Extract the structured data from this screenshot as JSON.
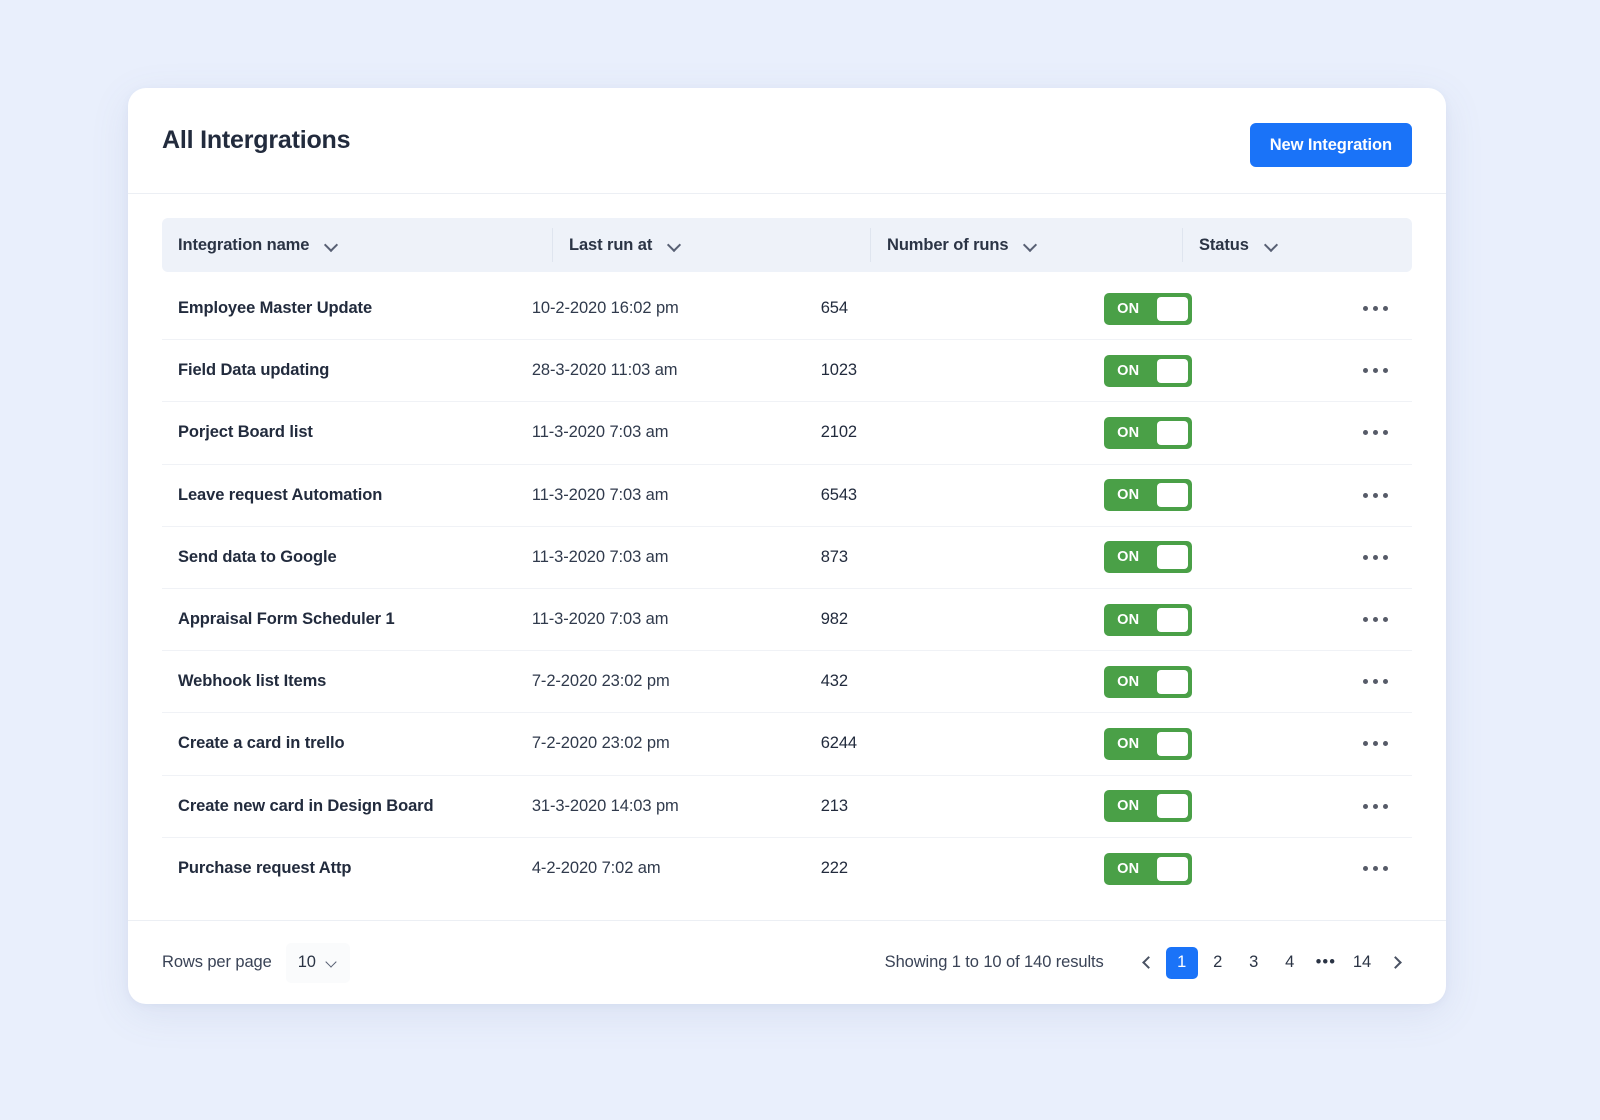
{
  "header": {
    "title": "All Intergrations",
    "new_integration_label": "New Integration"
  },
  "table": {
    "columns": [
      {
        "label": "Integration name",
        "sort_icon": "chevron-down-icon"
      },
      {
        "label": "Last run at",
        "sort_icon": "chevron-down-icon"
      },
      {
        "label": "Number of runs",
        "sort_icon": "chevron-down-icon"
      },
      {
        "label": "Status",
        "sort_icon": "chevron-down-icon"
      }
    ],
    "rows": [
      {
        "name": "Employee Master Update",
        "last_run": "10-2-2020 16:02 pm",
        "runs": "654",
        "status": "ON",
        "menu_icon": "ellipsis-horizontal-icon"
      },
      {
        "name": "Field Data updating",
        "last_run": "28-3-2020 11:03 am",
        "runs": "1023",
        "status": "ON",
        "menu_icon": "ellipsis-horizontal-icon"
      },
      {
        "name": "Porject Board list",
        "last_run": "11-3-2020 7:03 am",
        "runs": "2102",
        "status": "ON",
        "menu_icon": "ellipsis-horizontal-icon"
      },
      {
        "name": "Leave request Automation",
        "last_run": "11-3-2020 7:03 am",
        "runs": "6543",
        "status": "ON",
        "menu_icon": "ellipsis-horizontal-icon"
      },
      {
        "name": "Send data to Google",
        "last_run": "11-3-2020 7:03 am",
        "runs": "873",
        "status": "ON",
        "menu_icon": "ellipsis-horizontal-icon"
      },
      {
        "name": "Appraisal Form Scheduler 1",
        "last_run": "11-3-2020 7:03 am",
        "runs": "982",
        "status": "ON",
        "menu_icon": "ellipsis-horizontal-icon"
      },
      {
        "name": "Webhook list Items",
        "last_run": "7-2-2020 23:02 pm",
        "runs": "432",
        "status": "ON",
        "menu_icon": "ellipsis-horizontal-icon"
      },
      {
        "name": "Create a card in trello",
        "last_run": "7-2-2020 23:02 pm",
        "runs": "6244",
        "status": "ON",
        "menu_icon": "ellipsis-horizontal-icon"
      },
      {
        "name": "Create new card in Design Board",
        "last_run": "31-3-2020 14:03 pm",
        "runs": "213",
        "status": "ON",
        "menu_icon": "ellipsis-horizontal-icon"
      },
      {
        "name": "Purchase request Attp",
        "last_run": "4-2-2020 7:02 am",
        "runs": "222",
        "status": "ON",
        "menu_icon": "ellipsis-horizontal-icon"
      }
    ]
  },
  "footer": {
    "rows_per_page_label": "Rows per page",
    "rows_per_page_value": "10",
    "showing_text": "Showing 1 to 10 of 140 results",
    "pagination": {
      "prev_icon": "chevron-left-icon",
      "next_icon": "chevron-right-icon",
      "pages": [
        "1",
        "2",
        "3",
        "4",
        "•••",
        "14"
      ],
      "active_page": "1"
    }
  },
  "colors": {
    "page_background": "#e9effc",
    "accent_blue": "#1a73f8",
    "toggle_green": "#4aa047",
    "header_band": "#eef2f9"
  }
}
